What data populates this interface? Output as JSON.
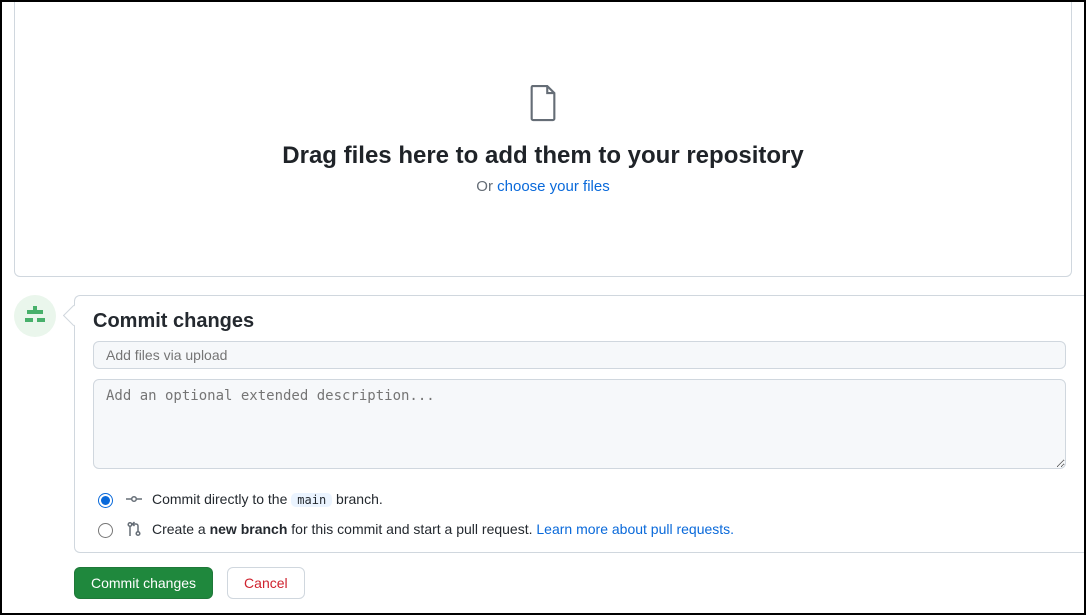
{
  "dropzone": {
    "title": "Drag files here to add them to your repository",
    "or_text": "Or ",
    "choose_link": "choose your files"
  },
  "commit": {
    "heading": "Commit changes",
    "summary_placeholder": "Add files via upload",
    "description_placeholder": "Add an optional extended description...",
    "option_direct_prefix": "Commit directly to the ",
    "option_direct_branch": "main",
    "option_direct_suffix": " branch.",
    "option_branch_prefix": "Create a ",
    "option_branch_bold": "new branch",
    "option_branch_suffix": " for this commit and start a pull request. ",
    "learn_more": "Learn more about pull requests.",
    "commit_button": "Commit changes",
    "cancel_button": "Cancel"
  }
}
